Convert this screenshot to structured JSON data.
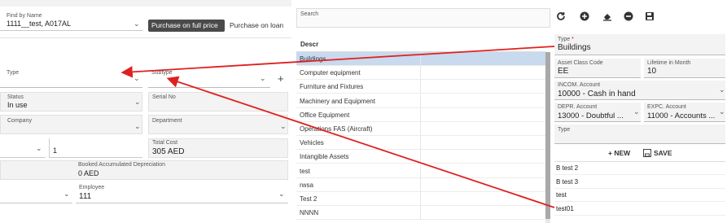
{
  "left": {
    "find_by_name": {
      "label": "Find by Name",
      "value": "1111__test, A017AL"
    },
    "purchase_full_btn": "Purchase on full price",
    "purchase_loan_btn": "Purchase on loan",
    "type": {
      "label": "Type"
    },
    "subtype": {
      "label": "Subtype"
    },
    "add_symbol": "+",
    "status": {
      "label": "Status",
      "value": "In use"
    },
    "serial": {
      "label": "Serial No"
    },
    "company": {
      "label": "Company"
    },
    "department": {
      "label": "Department"
    },
    "qty_value": "1",
    "total_cost": {
      "label": "Total Cost",
      "value": "305 AED"
    },
    "booked_dep": {
      "label": "Booked Accumulated Depreciation",
      "value": "0 AED"
    },
    "employee": {
      "label": "Employee",
      "value": "111"
    }
  },
  "middle": {
    "search_label": "Search",
    "column_header": "Descr",
    "rows": [
      "Buildings",
      "Computer equipment",
      "Furniture and Fixtures",
      "Machinery and Equipment",
      "Office Equipment",
      "Operations FAS (Aircraft)",
      "Vehicles",
      "Intangible Assets",
      "test",
      "rwsa",
      "Test 2",
      "NNNN"
    ]
  },
  "right": {
    "toolbar_icons": [
      "refresh-icon",
      "add-circle-icon",
      "eraser-icon",
      "remove-circle-icon",
      "save-icon"
    ],
    "type": {
      "label": "Type",
      "required_mark": "*",
      "value": "Buildings"
    },
    "asset_class_code": {
      "label": "Asset Class Code",
      "value": "EE"
    },
    "lifetime": {
      "label": "Lifetime in Month",
      "value": "10"
    },
    "incom_account": {
      "label": "INCOM. Account",
      "value": "10000 - Cash in hand"
    },
    "depr_account": {
      "label": "DEPR. Account",
      "value": "13000 - Doubtful ..."
    },
    "expc_account": {
      "label": "EXPC. Account",
      "value": "11000 - Accounts ..."
    },
    "subtype_label": "Type",
    "new_btn": "+ NEW",
    "save_btn": "SAVE",
    "list": [
      "B test 2",
      "B test 3",
      "test",
      "test01"
    ]
  },
  "colors": {
    "arrow": "#e02020",
    "selected_row": "#c9d9ee",
    "dark_button": "#4a4a4a"
  }
}
